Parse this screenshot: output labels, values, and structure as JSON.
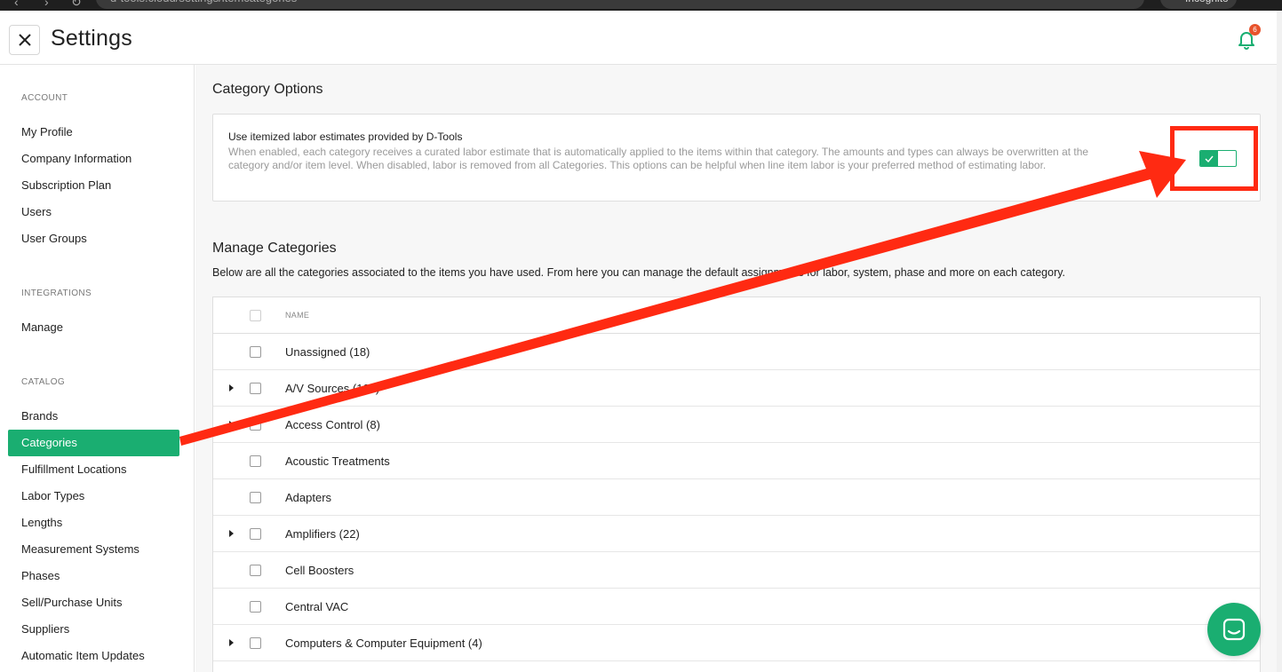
{
  "browser": {
    "url": "d-tools.cloud/settings/itemcategories",
    "profile": "Incognito"
  },
  "header": {
    "title": "Settings",
    "notification_count": "6"
  },
  "sidebar": {
    "sections": [
      {
        "label": "ACCOUNT",
        "items": [
          "My Profile",
          "Company Information",
          "Subscription Plan",
          "Users",
          "User Groups"
        ]
      },
      {
        "label": "INTEGRATIONS",
        "items": [
          "Manage"
        ]
      },
      {
        "label": "CATALOG",
        "items": [
          "Brands",
          "Categories",
          "Fulfillment Locations",
          "Labor Types",
          "Lengths",
          "Measurement Systems",
          "Phases",
          "Sell/Purchase Units",
          "Suppliers",
          "Automatic Item Updates"
        ]
      }
    ],
    "active_item": "Categories"
  },
  "category_options": {
    "heading": "Category Options",
    "option_title": "Use itemized labor estimates provided by D-Tools",
    "option_description": "When enabled, each category receives a curated labor estimate that is automatically applied to the items within that category. The amounts and types can always be overwritten at the category and/or item level. When disabled, labor is removed from all Categories. This options can be helpful when line item labor is your preferred method of estimating labor.",
    "toggle_enabled": true
  },
  "manage_categories": {
    "heading": "Manage Categories",
    "description": "Below are all the categories associated to the items you have used. From here you can manage the default assignments for labor, system, phase and more on each category.",
    "column_name": "NAME",
    "rows": [
      {
        "label": "Unassigned  (18)",
        "expandable": false
      },
      {
        "label": "A/V Sources  (169)",
        "expandable": true
      },
      {
        "label": "Access Control  (8)",
        "expandable": true
      },
      {
        "label": "Acoustic Treatments",
        "expandable": false
      },
      {
        "label": "Adapters",
        "expandable": false
      },
      {
        "label": "Amplifiers  (22)",
        "expandable": true
      },
      {
        "label": "Cell Boosters",
        "expandable": false
      },
      {
        "label": "Central VAC",
        "expandable": false
      },
      {
        "label": "Computers & Computer Equipment  (4)",
        "expandable": true
      }
    ]
  },
  "colors": {
    "accent": "#1aae71",
    "annotation": "#ff2a12",
    "badge": "#e8532c"
  },
  "icons": [
    "close-icon",
    "bell-icon",
    "check-icon",
    "chat-icon",
    "caret-right-icon"
  ]
}
